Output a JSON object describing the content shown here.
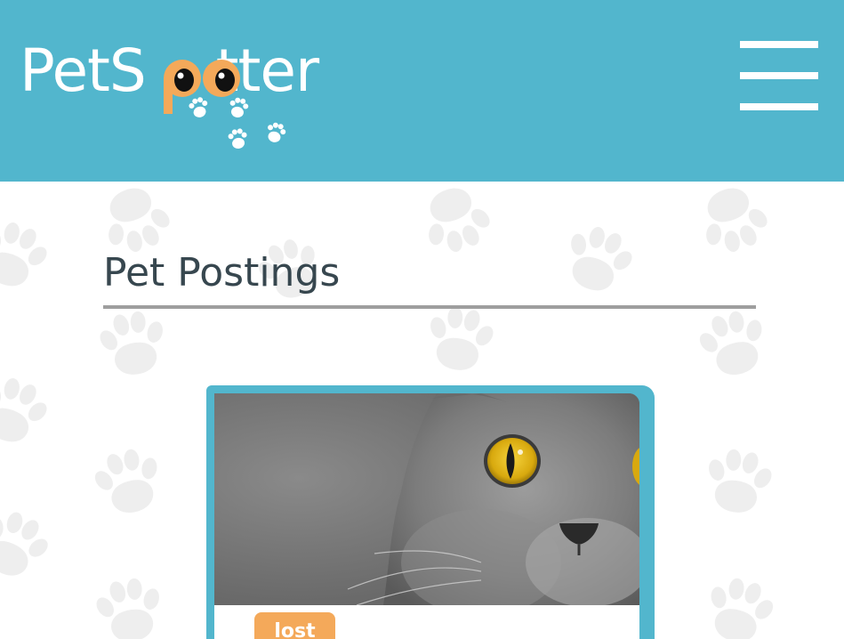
{
  "header": {
    "brand": {
      "prefix": "PetS",
      "eyes": "oo",
      "suffix": "tter"
    },
    "menu_icon": "hamburger-menu-icon"
  },
  "main": {
    "title": "Pet Postings",
    "posts": [
      {
        "status": "lost",
        "photo": "gray-cat-photo"
      }
    ]
  },
  "colors": {
    "header_bg": "#52b6cd",
    "accent_orange": "#f4a95a",
    "title_text": "#37474f",
    "rule": "#9e9e9e",
    "paw_bg": "#eeeeee"
  }
}
